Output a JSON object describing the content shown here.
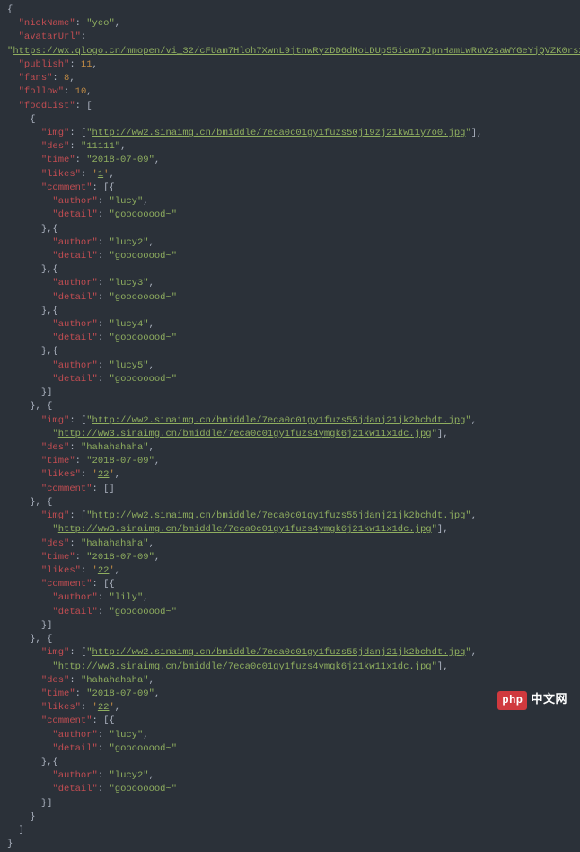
{
  "nickName": "yeo",
  "avatarUrl": "https://wx.qlogo.cn/mmopen/vi_32/cFUam7Hloh7XwnL9jtnwRyzDD6dMoLDUp55icwn7JpnHamLwRuV2saWYGeYjQVZK0rs209gk2dr4aaH0p40wbow/132",
  "publish": 11,
  "fans": 8,
  "follow": 10,
  "foodList": [
    {
      "img": [
        "http://ww2.sinaimg.cn/bmiddle/7eca0c01gy1fuzs50j19zj21kw11y7o0.jpg"
      ],
      "des": "11111",
      "time": "2018-07-09",
      "likes": "1",
      "comment": [
        {
          "author": "lucy",
          "detail": "goooooood~"
        },
        {
          "author": "lucy2",
          "detail": "goooooood~"
        },
        {
          "author": "lucy3",
          "detail": "goooooood~"
        },
        {
          "author": "lucy4",
          "detail": "goooooood~"
        },
        {
          "author": "lucy5",
          "detail": "goooooood~"
        }
      ]
    },
    {
      "img": [
        "http://ww2.sinaimg.cn/bmiddle/7eca0c01gy1fuzs55jdanj21jk2bchdt.jpg",
        "http://ww3.sinaimg.cn/bmiddle/7eca0c01gy1fuzs4ymgk6j21kw11x1dc.jpg"
      ],
      "des": "hahahahaha",
      "time": "2018-07-09",
      "likes": "22",
      "comment": []
    },
    {
      "img": [
        "http://ww2.sinaimg.cn/bmiddle/7eca0c01gy1fuzs55jdanj21jk2bchdt.jpg",
        "http://ww3.sinaimg.cn/bmiddle/7eca0c01gy1fuzs4ymgk6j21kw11x1dc.jpg"
      ],
      "des": "hahahahaha",
      "time": "2018-07-09",
      "likes": "22",
      "comment": [
        {
          "author": "lily",
          "detail": "goooooood~"
        }
      ]
    },
    {
      "img": [
        "http://ww2.sinaimg.cn/bmiddle/7eca0c01gy1fuzs55jdanj21jk2bchdt.jpg",
        "http://ww3.sinaimg.cn/bmiddle/7eca0c01gy1fuzs4ymgk6j21kw11x1dc.jpg"
      ],
      "des": "hahahahaha",
      "time": "2018-07-09",
      "likes": "22",
      "comment": [
        {
          "author": "lucy",
          "detail": "goooooood~"
        },
        {
          "author": "lucy2",
          "detail": "goooooood~"
        }
      ]
    }
  ],
  "watermark": {
    "logo": "php",
    "text": "中文网"
  }
}
